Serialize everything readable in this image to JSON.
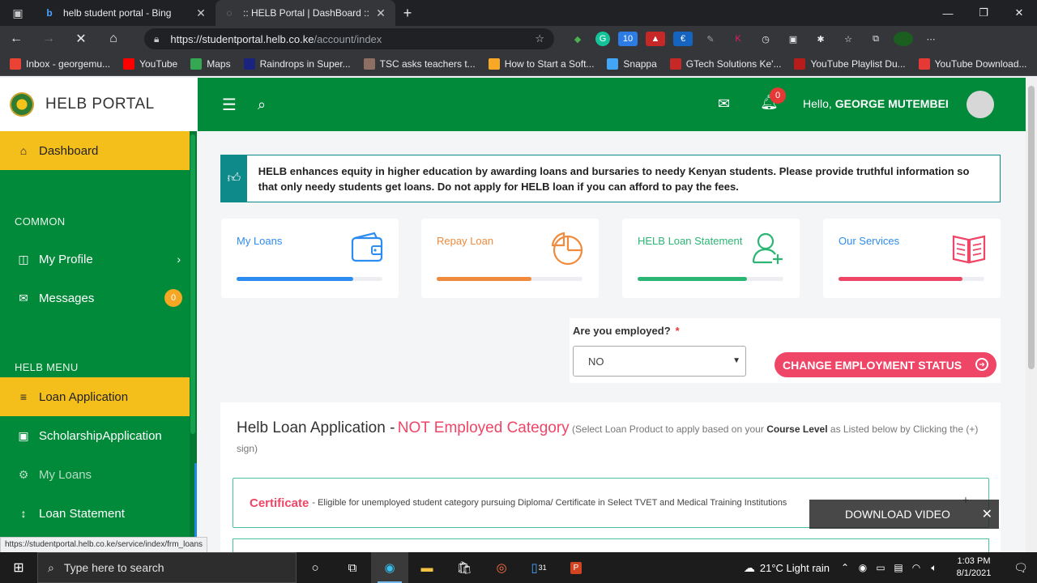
{
  "browser": {
    "tabs": [
      {
        "title": "helb student portal - Bing",
        "favicon": "bing-icon"
      },
      {
        "title": ":: HELB Portal | DashBoard ::",
        "favicon": "loading-icon"
      }
    ],
    "url_host": "https://studentportal.helb.co.ke",
    "url_path": "/account/index",
    "bookmarks": [
      {
        "label": "Inbox - georgemu...",
        "color": "#ea4335",
        "icon": "gmail-icon"
      },
      {
        "label": "YouTube",
        "color": "#ff0000",
        "icon": "youtube-icon"
      },
      {
        "label": "Maps",
        "color": "#34a853",
        "icon": "maps-icon"
      },
      {
        "label": "Raindrops in Super...",
        "color": "#1a237e",
        "icon": "v-icon"
      },
      {
        "label": "TSC asks teachers t...",
        "color": "#8d6e63",
        "icon": "tsc-icon"
      },
      {
        "label": "How to Start a Soft...",
        "color": "#f9a825",
        "icon": "box-icon"
      },
      {
        "label": "Snappa",
        "color": "#42a5f5",
        "icon": "snappa-icon"
      },
      {
        "label": "GTech Solutions Ke'...",
        "color": "#c62828",
        "icon": "chart-icon"
      },
      {
        "label": "YouTube Playlist Du...",
        "color": "#b71c1c",
        "icon": "playlist-icon"
      },
      {
        "label": "YouTube Download...",
        "color": "#e53935",
        "icon": "download-icon"
      }
    ]
  },
  "sidebar": {
    "brand": "HELB PORTAL",
    "dashboard": "Dashboard",
    "section_common": "COMMON",
    "my_profile": "My Profile",
    "messages": "Messages",
    "messages_badge": "0",
    "section_menu": "HELB MENU",
    "loan_application": "Loan Application",
    "scholarship_application": "ScholarshipApplication",
    "my_loans": "My Loans",
    "loan_statement": "Loan Statement"
  },
  "topbar": {
    "notifications_count": "0",
    "hello": "Hello,",
    "user_name": "GEORGE MUTEMBEI"
  },
  "notice": "HELB enhances equity in higher education by awarding loans and bursaries to needy Kenyan students. Please provide truthful information so that only needy students get loans. Do not apply for HELB loan if you can afford to pay the fees.",
  "cards": [
    {
      "title": "My Loans",
      "color": "#2d8cf0",
      "progress": 0.8
    },
    {
      "title": "Repay Loan",
      "color": "#f08a3c",
      "progress": 0.65
    },
    {
      "title": "HELB Loan Statement",
      "color": "#2bb673",
      "progress": 0.75
    },
    {
      "title": "Our Services",
      "color": "#ef4566",
      "progress": 0.85
    }
  ],
  "employment": {
    "label": "Are you employed?",
    "required_mark": "*",
    "selected": "NO",
    "button": "CHANGE EMPLOYMENT STATUS"
  },
  "application": {
    "heading": "Helb Loan Application -",
    "category": "NOT Employed Category",
    "hint_1": "(Select Loan Product to apply based on your",
    "hint_bold": "Course Level",
    "hint_2": "as Listed below by Clicking the (+) sign)",
    "item_name": "Certificate",
    "item_desc": "- Eligible for unemployed student category pursuing Diploma/ Certificate in Select TVET and Medical Training Institutions",
    "plus": "+"
  },
  "overlay": {
    "label": "DOWNLOAD VIDEO"
  },
  "status_url": "https://studentportal.helb.co.ke/service/index/frm_loans",
  "taskbar": {
    "search_placeholder": "Type here to search",
    "weather": "21°C  Light rain",
    "time": "1:03 PM",
    "date": "8/1/2021",
    "calendar_badge": "31"
  }
}
